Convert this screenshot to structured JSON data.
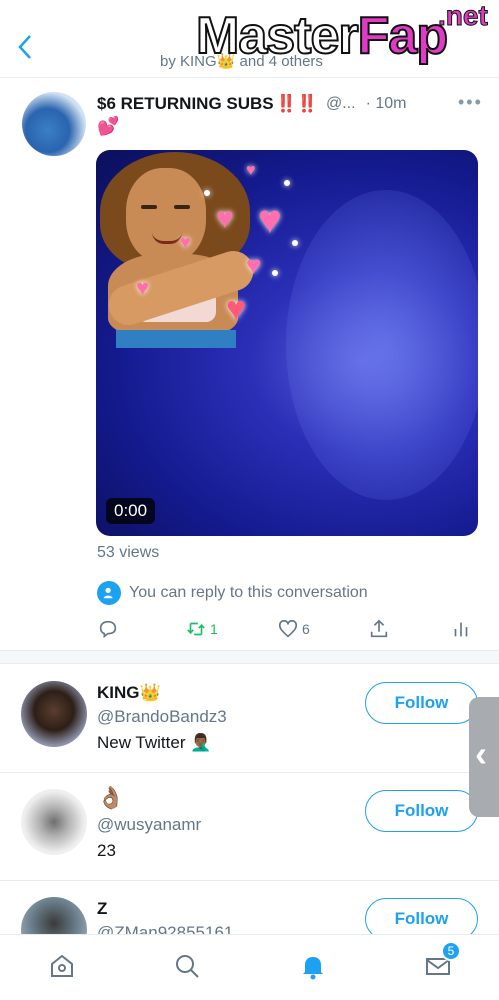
{
  "header": {
    "subtitle": "by KING👑 and 4 others",
    "watermark_main": "Master",
    "watermark_fap": "Fap",
    "watermark_net": ".net"
  },
  "tweet": {
    "title": "$6 RETURNING SUBS",
    "emphasis": "‼️‼️",
    "handle": "@...",
    "time": "· 10m",
    "emoji_line": "💕",
    "video_duration": "0:00",
    "views": "53 views",
    "reply_note": "You can reply to this conversation",
    "retweets": "1",
    "likes": "6"
  },
  "users": [
    {
      "name": "KING👑",
      "handle": "@BrandoBandz3",
      "bio": "New Twitter 🤦🏾‍♂️",
      "follow_label": "Follow"
    },
    {
      "name": "👌🏽",
      "handle": "@wusyanamr",
      "bio": "23",
      "follow_label": "Follow"
    },
    {
      "name": "Z",
      "handle": "@ZMan92855161",
      "bio": "",
      "follow_label": "Follow"
    }
  ],
  "nav": {
    "messages_badge": "5"
  },
  "colors": {
    "accent": "#1da1f2",
    "retweet": "#17bf63",
    "muted": "#657786"
  }
}
